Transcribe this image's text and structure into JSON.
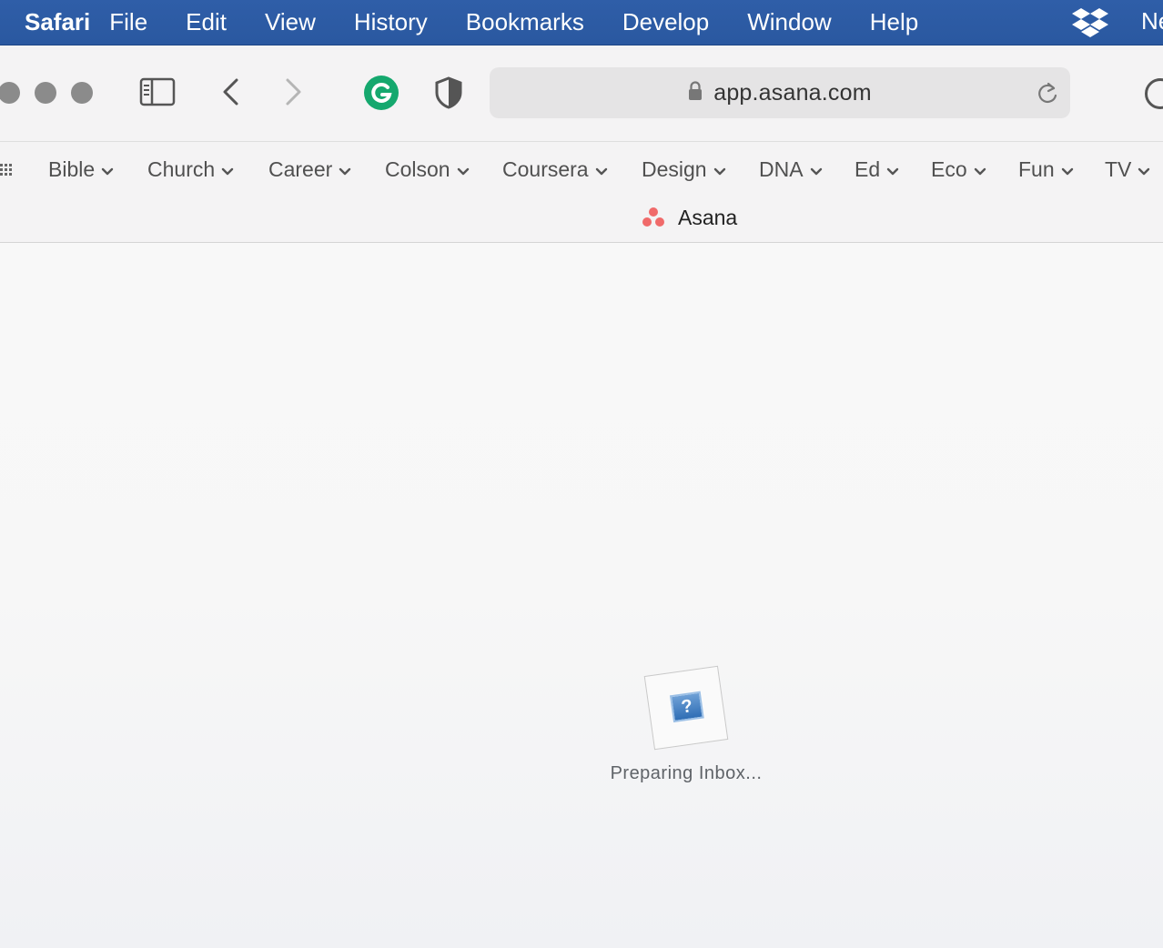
{
  "menubar": {
    "app_name": "Safari",
    "items": [
      "File",
      "Edit",
      "View",
      "History",
      "Bookmarks",
      "Develop",
      "Window",
      "Help"
    ],
    "right_icon": "dropbox-icon",
    "cut_text": "Ne"
  },
  "toolbar": {
    "url": "app.asana.com",
    "icons": [
      "sidebar-icon",
      "back-chevron-icon",
      "forward-chevron-icon",
      "grammarly-icon",
      "privacy-shield-icon",
      "lock-icon",
      "reload-icon",
      "downloads-icon"
    ]
  },
  "bookmarks": {
    "folders": [
      "Bible",
      "Church",
      "Career",
      "Colson",
      "Coursera",
      "Design",
      "DNA",
      "Ed",
      "Eco",
      "Fun",
      "TV"
    ],
    "link": "Asana"
  },
  "main": {
    "loading_text": "Preparing Inbox...",
    "placeholder_glyph": "?"
  },
  "colors": {
    "menubar": "#2f5ea8",
    "asana_accent": "#f06a6a",
    "grammarly": "#15c39a"
  }
}
